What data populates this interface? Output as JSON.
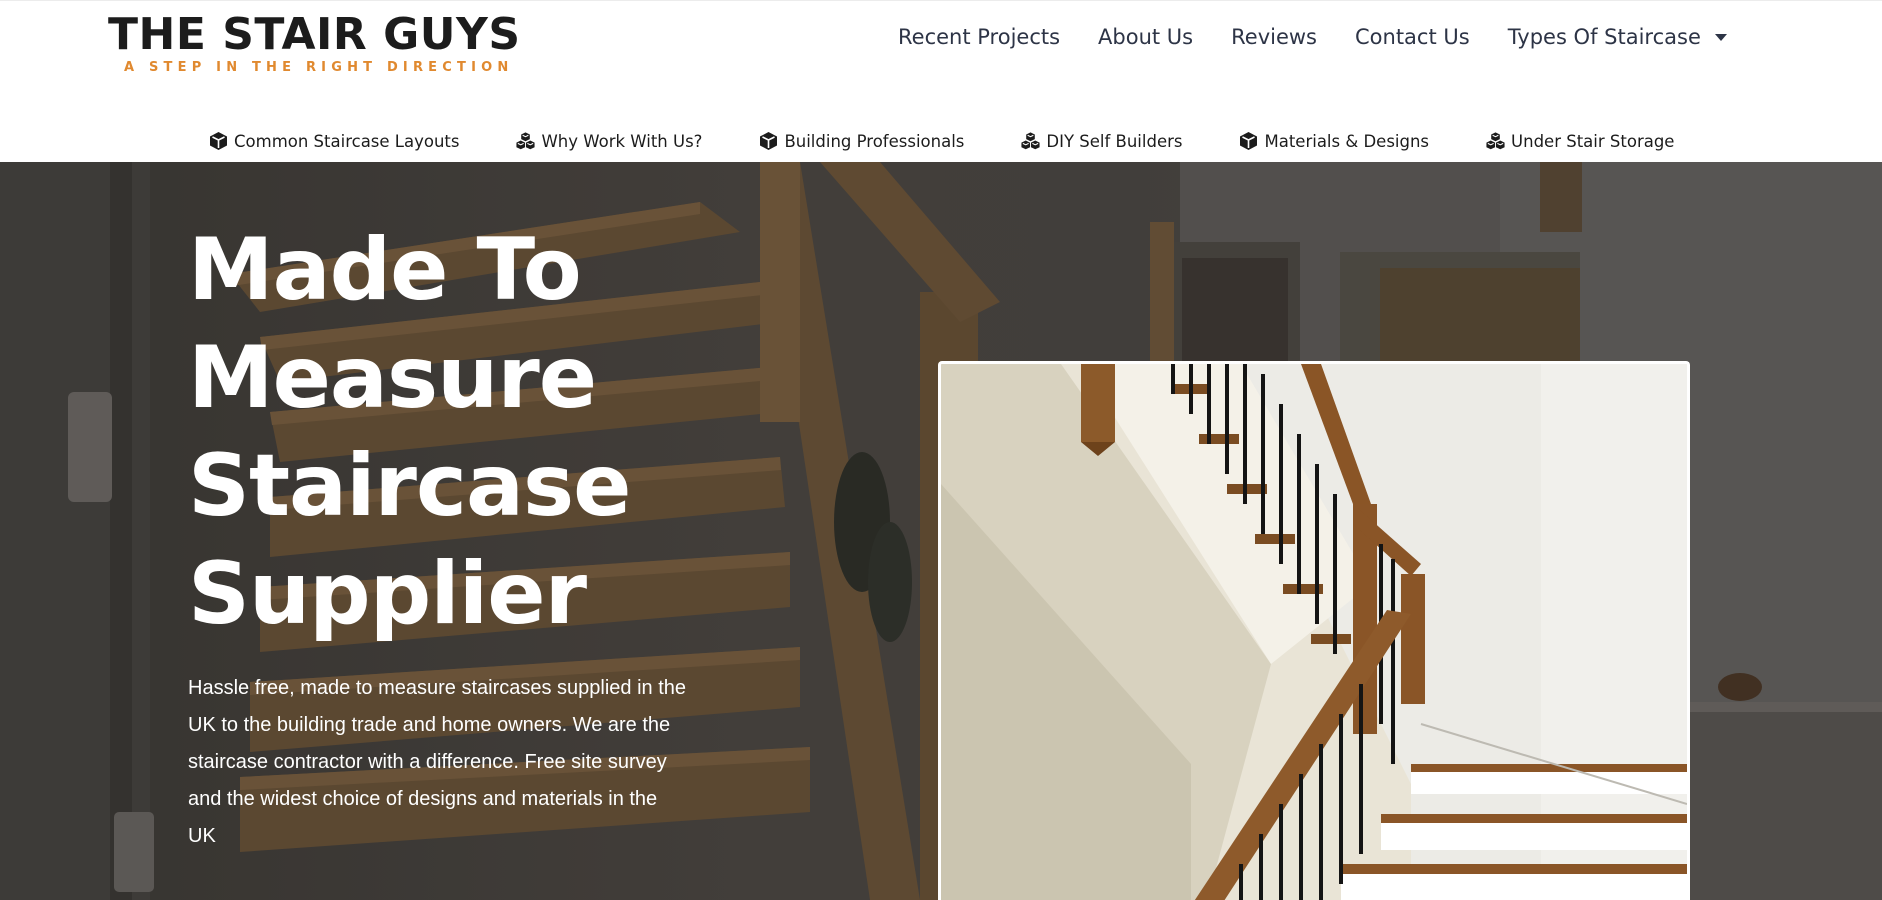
{
  "brand": {
    "name": "THE STAIR GUYS",
    "tagline": "A STEP IN THE RIGHT DIRECTION",
    "accent_color": "#e0892f",
    "text_color": "#1c1c1c"
  },
  "main_nav": {
    "items": [
      {
        "label": "Recent Projects"
      },
      {
        "label": "About Us"
      },
      {
        "label": "Reviews"
      },
      {
        "label": "Contact Us"
      },
      {
        "label": "Types Of Staircase",
        "icon": "caret-down-icon"
      }
    ]
  },
  "sub_nav": {
    "items": [
      {
        "label": "Common Staircase Layouts",
        "icon": "cube-icon"
      },
      {
        "label": "Why Work With Us?",
        "icon": "cubes-icon"
      },
      {
        "label": "Building Professionals",
        "icon": "cube-icon"
      },
      {
        "label": "DIY Self Builders",
        "icon": "cubes-icon"
      },
      {
        "label": "Materials & Designs",
        "icon": "cube-icon"
      },
      {
        "label": "Under Stair Storage",
        "icon": "cubes-icon"
      }
    ]
  },
  "hero": {
    "heading_lines": [
      "Made To",
      "Measure",
      "Staircase",
      "Supplier"
    ],
    "description": "Hassle free, made to measure staircases supplied in the UK to the building trade and home owners. We are the staircase contractor with a difference.  Free site survey and the widest choice of designs and materials in the UK",
    "background_image": "oak-staircase-photo",
    "feature_image": "white-staircase-black-spindles-photo"
  }
}
